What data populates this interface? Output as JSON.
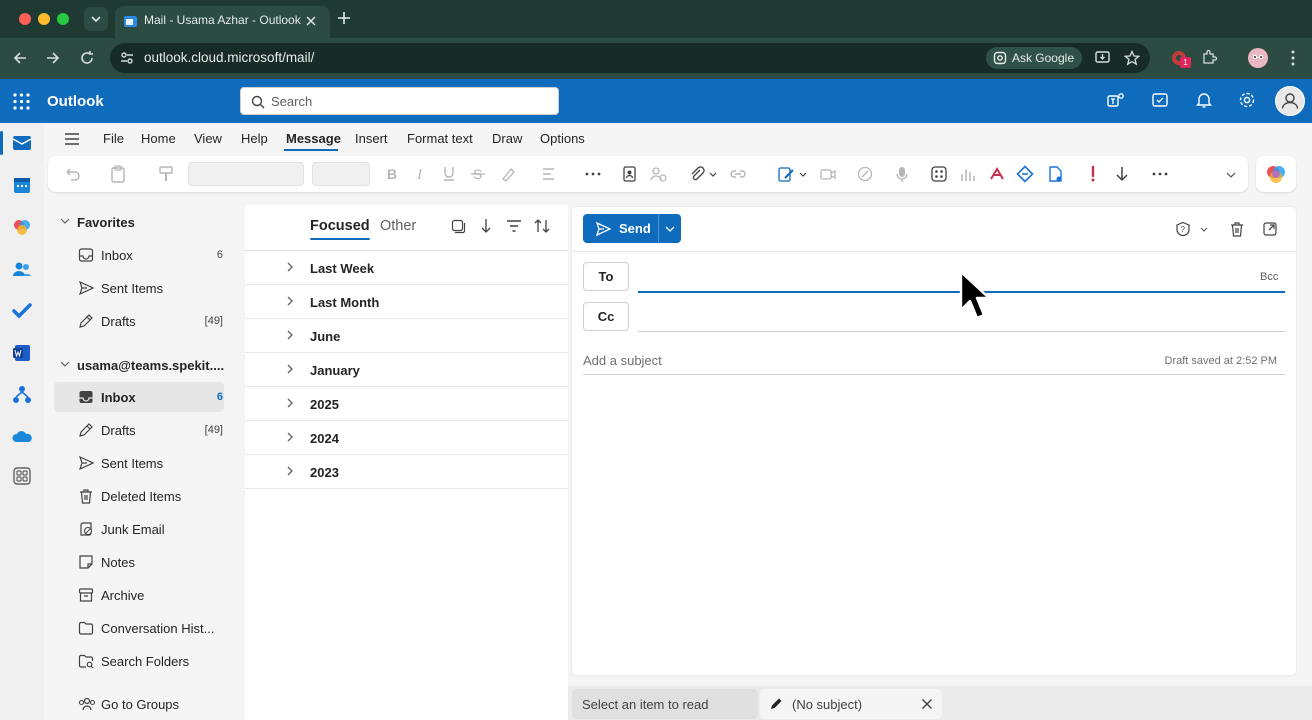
{
  "browser": {
    "tab_title": "Mail - Usama Azhar - Outlook",
    "url": "outlook.cloud.microsoft/mail/",
    "ask_google": "Ask Google",
    "extension_badge": "1"
  },
  "header": {
    "app_name": "Outlook",
    "search_placeholder": "Search"
  },
  "ribbon": {
    "tabs": [
      "File",
      "Home",
      "View",
      "Help",
      "Message",
      "Insert",
      "Format text",
      "Draw",
      "Options"
    ],
    "active_tab": "Message"
  },
  "folders": {
    "favorites_label": "Favorites",
    "favorites": [
      {
        "label": "Inbox",
        "count": "6",
        "icon": "inbox-icon"
      },
      {
        "label": "Sent Items",
        "count": "",
        "icon": "send-icon"
      },
      {
        "label": "Drafts",
        "count": "[49]",
        "icon": "drafts-icon"
      }
    ],
    "account_label": "usama@teams.spekit....",
    "account": [
      {
        "label": "Inbox",
        "count": "6",
        "icon": "inbox-icon",
        "selected": true
      },
      {
        "label": "Drafts",
        "count": "[49]",
        "icon": "drafts-icon"
      },
      {
        "label": "Sent Items",
        "count": "",
        "icon": "send-icon"
      },
      {
        "label": "Deleted Items",
        "count": "",
        "icon": "trash-icon"
      },
      {
        "label": "Junk Email",
        "count": "",
        "icon": "junk-icon"
      },
      {
        "label": "Notes",
        "count": "",
        "icon": "notes-icon"
      },
      {
        "label": "Archive",
        "count": "",
        "icon": "archive-icon"
      },
      {
        "label": "Conversation Hist...",
        "count": "",
        "icon": "folder-icon"
      },
      {
        "label": "Search Folders",
        "count": "",
        "icon": "search-folder-icon"
      }
    ],
    "groups_label": "Go to Groups"
  },
  "message_list": {
    "focused_label": "Focused",
    "other_label": "Other",
    "groups": [
      "Last Week",
      "Last Month",
      "June",
      "January",
      "2025",
      "2024",
      "2023"
    ]
  },
  "compose": {
    "send_label": "Send",
    "to_label": "To",
    "cc_label": "Cc",
    "bcc_label": "Bcc",
    "subject_placeholder": "Add a subject",
    "draft_status": "Draft saved at 2:52 PM"
  },
  "bottom_bar": {
    "reading_tab": "Select an item to read",
    "draft_tab": "(No subject)"
  },
  "colors": {
    "brand": "#0f6cbd",
    "browser_frame": "#1f3a33",
    "browser_toolbar": "#2c4b43"
  }
}
